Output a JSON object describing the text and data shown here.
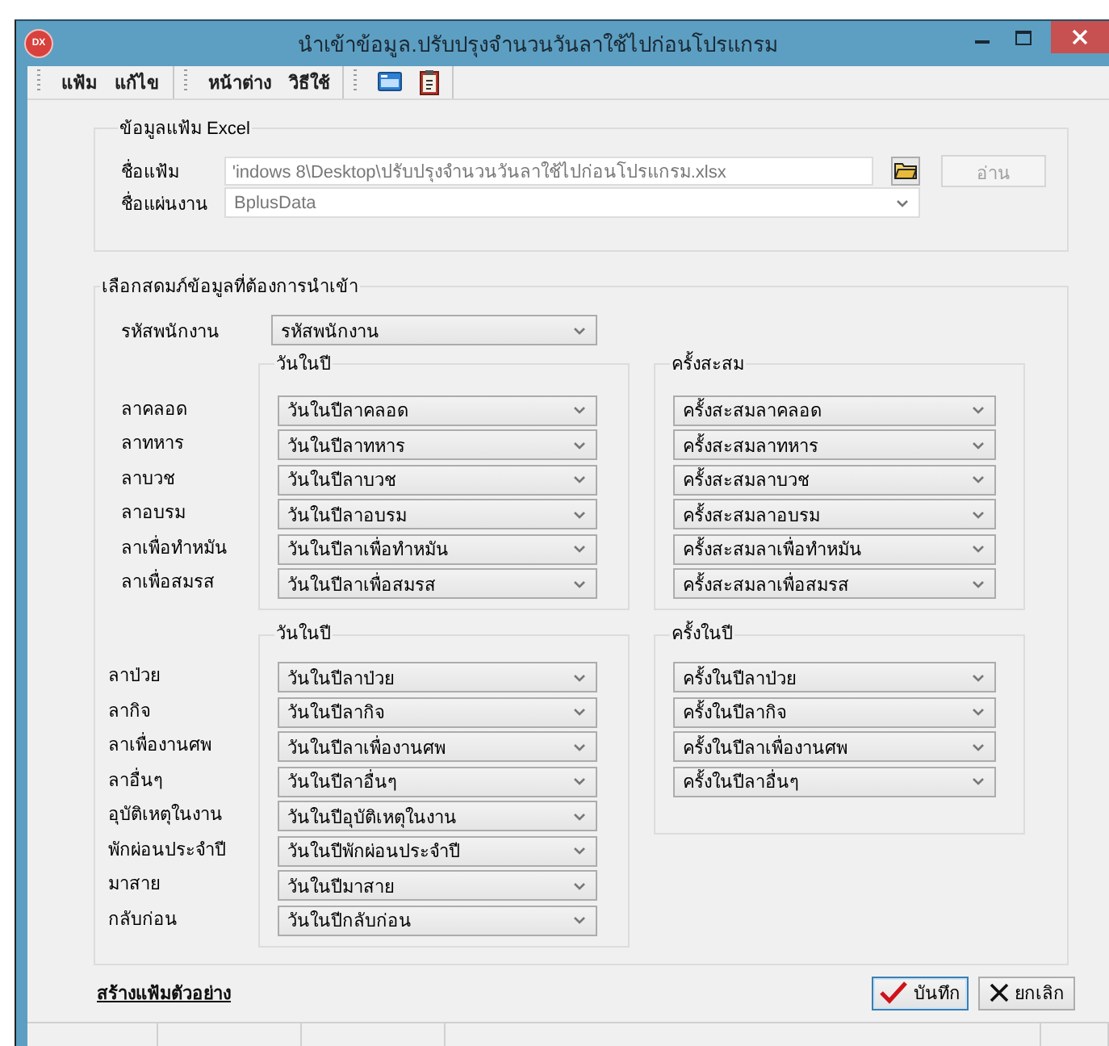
{
  "window": {
    "title": "นำเข้าข้อมูล.ปรับปรุงจำนวนวันลาใช้ไปก่อนโปรแกรม",
    "app_icon": "DX"
  },
  "menu_groups": [
    {
      "items": [
        "แฟ้ม",
        "แก้ไข"
      ]
    },
    {
      "items": [
        "หน้าต่าง",
        "วิธีใช้"
      ]
    }
  ],
  "excel_group": {
    "title": "ข้อมูลแฟ้ม Excel",
    "file_label": "ชื่อแฟ้ม",
    "file_value": "'indows 8\\Desktop\\ปรับปรุงจำนวนวันลาใช้ไปก่อนโปรแกรม.xlsx",
    "read_button": {
      "label": "อ่าน",
      "disabled": true
    },
    "sheet_label": "ชื่อแผ่นงาน",
    "sheet_value": "BplusData"
  },
  "mapping_group": {
    "title": "เลือกสดมภ์ข้อมูลที่ต้องการนำเข้า",
    "employee_code": {
      "label": "รหัสพนักงาน",
      "value": "รหัสพนักงาน"
    },
    "sections": [
      {
        "days_title": "วันในปี",
        "times_title": "ครั้งสะสม",
        "rows": [
          {
            "label": "ลาคลอด",
            "days": "วันในปีลาคลอด",
            "times": "ครั้งสะสมลาคลอด"
          },
          {
            "label": "ลาทหาร",
            "days": "วันในปีลาทหาร",
            "times": "ครั้งสะสมลาทหาร"
          },
          {
            "label": "ลาบวช",
            "days": "วันในปีลาบวช",
            "times": "ครั้งสะสมลาบวช"
          },
          {
            "label": "ลาอบรม",
            "days": "วันในปีลาอบรม",
            "times": "ครั้งสะสมลาอบรม"
          },
          {
            "label": "ลาเพื่อทำหมัน",
            "days": "วันในปีลาเพื่อทำหมัน",
            "times": "ครั้งสะสมลาเพื่อทำหมัน"
          },
          {
            "label": "ลาเพื่อสมรส",
            "days": "วันในปีลาเพื่อสมรส",
            "times": "ครั้งสะสมลาเพื่อสมรส"
          }
        ]
      },
      {
        "days_title": "วันในปี",
        "times_title": "ครั้งในปี",
        "rows": [
          {
            "label": "ลาป่วย",
            "days": "วันในปีลาป่วย",
            "times": "ครั้งในปีลาป่วย"
          },
          {
            "label": "ลากิจ",
            "days": "วันในปีลากิจ",
            "times": "ครั้งในปีลากิจ"
          },
          {
            "label": "ลาเพื่องานศพ",
            "days": "วันในปีลาเพื่องานศพ",
            "times": "ครั้งในปีลาเพื่องานศพ"
          },
          {
            "label": "ลาอื่นๆ",
            "days": "วันในปีลาอื่นๆ",
            "times": "ครั้งในปีลาอื่นๆ"
          },
          {
            "label": "อุบัติเหตุในงาน",
            "days": "วันในปีอุบัติเหตุในงาน"
          },
          {
            "label": "พักผ่อนประจำปี",
            "days": "วันในปีพักผ่อนประจำปี"
          },
          {
            "label": "มาสาย",
            "days": "วันในปีมาสาย"
          },
          {
            "label": "กลับก่อน",
            "days": "วันในปีกลับก่อน"
          }
        ]
      }
    ]
  },
  "footer": {
    "link": "สร้างแฟ้มตัวอย่าง",
    "buttons": [
      {
        "kind": "save",
        "label": "บันทึก",
        "focused": true
      },
      {
        "kind": "cancel",
        "label": "ยกเลิก",
        "focused": false
      }
    ]
  }
}
